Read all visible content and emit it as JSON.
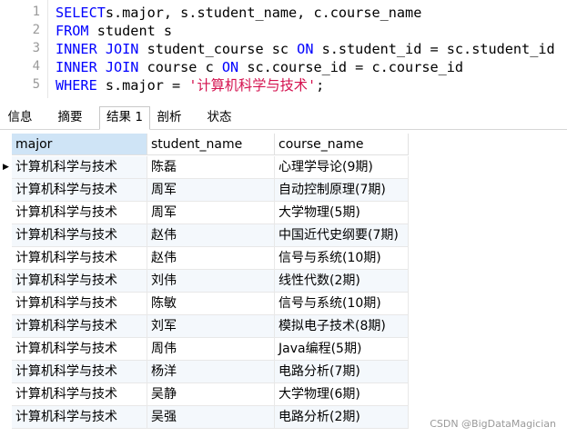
{
  "editor": {
    "lines": [
      {
        "num": "1",
        "parts": [
          [
            "kw",
            "SELECT"
          ],
          [
            "",
            "s.major, s.student_name, c.course_name"
          ]
        ]
      },
      {
        "num": "2",
        "parts": [
          [
            "kw",
            "FROM"
          ],
          [
            "",
            " student s"
          ]
        ]
      },
      {
        "num": "3",
        "parts": [
          [
            "kw",
            "INNER JOIN"
          ],
          [
            "",
            " student_course sc "
          ],
          [
            "kw",
            "ON"
          ],
          [
            "",
            " s.student_id = sc.student_id"
          ]
        ]
      },
      {
        "num": "4",
        "parts": [
          [
            "kw",
            "INNER JOIN"
          ],
          [
            "",
            " course c "
          ],
          [
            "kw",
            "ON"
          ],
          [
            "",
            " sc.course_id = c.course_id"
          ]
        ]
      },
      {
        "num": "5",
        "parts": [
          [
            "kw",
            "WHERE"
          ],
          [
            "",
            " s.major = "
          ],
          [
            "str",
            "'计算机科学与技术'"
          ],
          [
            "",
            ";"
          ]
        ]
      }
    ]
  },
  "tabs": [
    {
      "label": "信息",
      "active": false
    },
    {
      "label": "摘要",
      "active": false
    },
    {
      "label": "结果 1",
      "active": true
    },
    {
      "label": "剖析",
      "active": false
    },
    {
      "label": "状态",
      "active": false
    }
  ],
  "grid": {
    "columns": [
      "major",
      "student_name",
      "course_name"
    ],
    "current_row_indicator": "▶",
    "rows": [
      [
        "计算机科学与技术",
        "陈磊",
        "心理学导论(9期)"
      ],
      [
        "计算机科学与技术",
        "周军",
        "自动控制原理(7期)"
      ],
      [
        "计算机科学与技术",
        "周军",
        "大学物理(5期)"
      ],
      [
        "计算机科学与技术",
        "赵伟",
        "中国近代史纲要(7期)"
      ],
      [
        "计算机科学与技术",
        "赵伟",
        "信号与系统(10期)"
      ],
      [
        "计算机科学与技术",
        "刘伟",
        "线性代数(2期)"
      ],
      [
        "计算机科学与技术",
        "陈敏",
        "信号与系统(10期)"
      ],
      [
        "计算机科学与技术",
        "刘军",
        "模拟电子技术(8期)"
      ],
      [
        "计算机科学与技术",
        "周伟",
        "Java编程(5期)"
      ],
      [
        "计算机科学与技术",
        "杨洋",
        "电路分析(7期)"
      ],
      [
        "计算机科学与技术",
        "吴静",
        "大学物理(6期)"
      ],
      [
        "计算机科学与技术",
        "吴强",
        "电路分析(2期)"
      ]
    ]
  },
  "watermark": "CSDN @BigDataMagician",
  "colors": {
    "keyword": "#0000ff",
    "string": "#d4124f",
    "header_selected": "#cfe4f6",
    "row_alt": "#f4f8fc"
  }
}
